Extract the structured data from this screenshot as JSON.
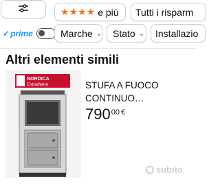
{
  "filters": {
    "row1": {
      "filter_icon": "sliders-icon",
      "stars_label": "e più",
      "stars_rating": 4,
      "tutti_label": "Tutti i risparm"
    },
    "row2": {
      "prime_label": "prime",
      "prime_toggle_on": false,
      "marche_label": "Marche",
      "stato_label": "Stato",
      "installazione_label": "Installazio"
    }
  },
  "section": {
    "title": "Altri elementi simili"
  },
  "product": {
    "title_line1": "STUFA A FUOCO",
    "title_line2": "CONTINUO…",
    "price_whole": "790",
    "price_decimal": "00",
    "currency": "€",
    "brand_logo_text": "NORDICA Extraflame"
  },
  "watermark": {
    "text": "subito"
  },
  "colors": {
    "star": "#de7921",
    "prime_blue": "#1a98ff",
    "chip_border": "#c9cccc",
    "logo_red": "#c8102e"
  }
}
